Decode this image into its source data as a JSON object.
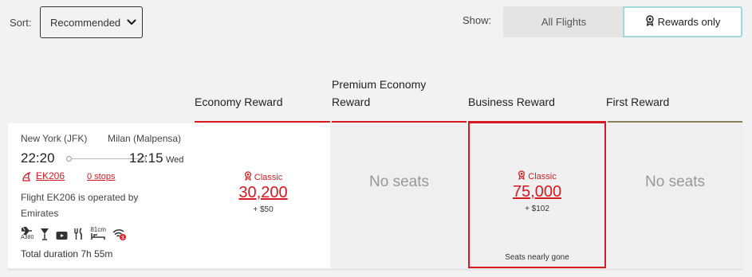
{
  "sort": {
    "label": "Sort:",
    "selected": "Recommended"
  },
  "show": {
    "label": "Show:",
    "all_flights": "All Flights",
    "rewards_only": "Rewards only"
  },
  "columns": [
    {
      "name": "Economy Reward",
      "line_color": "#d71921"
    },
    {
      "name": "Premium Economy Reward",
      "line_color": "#d71921"
    },
    {
      "name": "Business Reward",
      "line_color": "#d71921"
    },
    {
      "name": "First Reward",
      "line_color": "#8b7f62"
    }
  ],
  "flight": {
    "origin": "New York (JFK)",
    "destination": "Milan (Malpensa)",
    "depart_time": "22:20",
    "arrive_time": "12:15",
    "arrive_day": "Wed",
    "flight_number": "EK206",
    "stops": "0 stops",
    "operated_by": "Flight EK206 is operated by Emirates",
    "aircraft": "A380",
    "seat_pitch": "81cm",
    "duration": "Total duration 7h 55m",
    "amenities": [
      "plane-icon",
      "bar-icon",
      "entertainment-icon",
      "dining-icon",
      "seat-bed-icon",
      "wifi-paid-icon"
    ]
  },
  "fares": {
    "economy": {
      "type": "Classic",
      "points": "30,200",
      "tax": "+ $50"
    },
    "premium_economy": {
      "text": "No seats"
    },
    "business": {
      "type": "Classic",
      "points": "75,000",
      "tax": "+ $102",
      "note": "Seats nearly gone"
    },
    "first": {
      "text": "No seats"
    }
  },
  "colors": {
    "accent": "#d71921",
    "toggle_active_border": "#9fdad9"
  }
}
